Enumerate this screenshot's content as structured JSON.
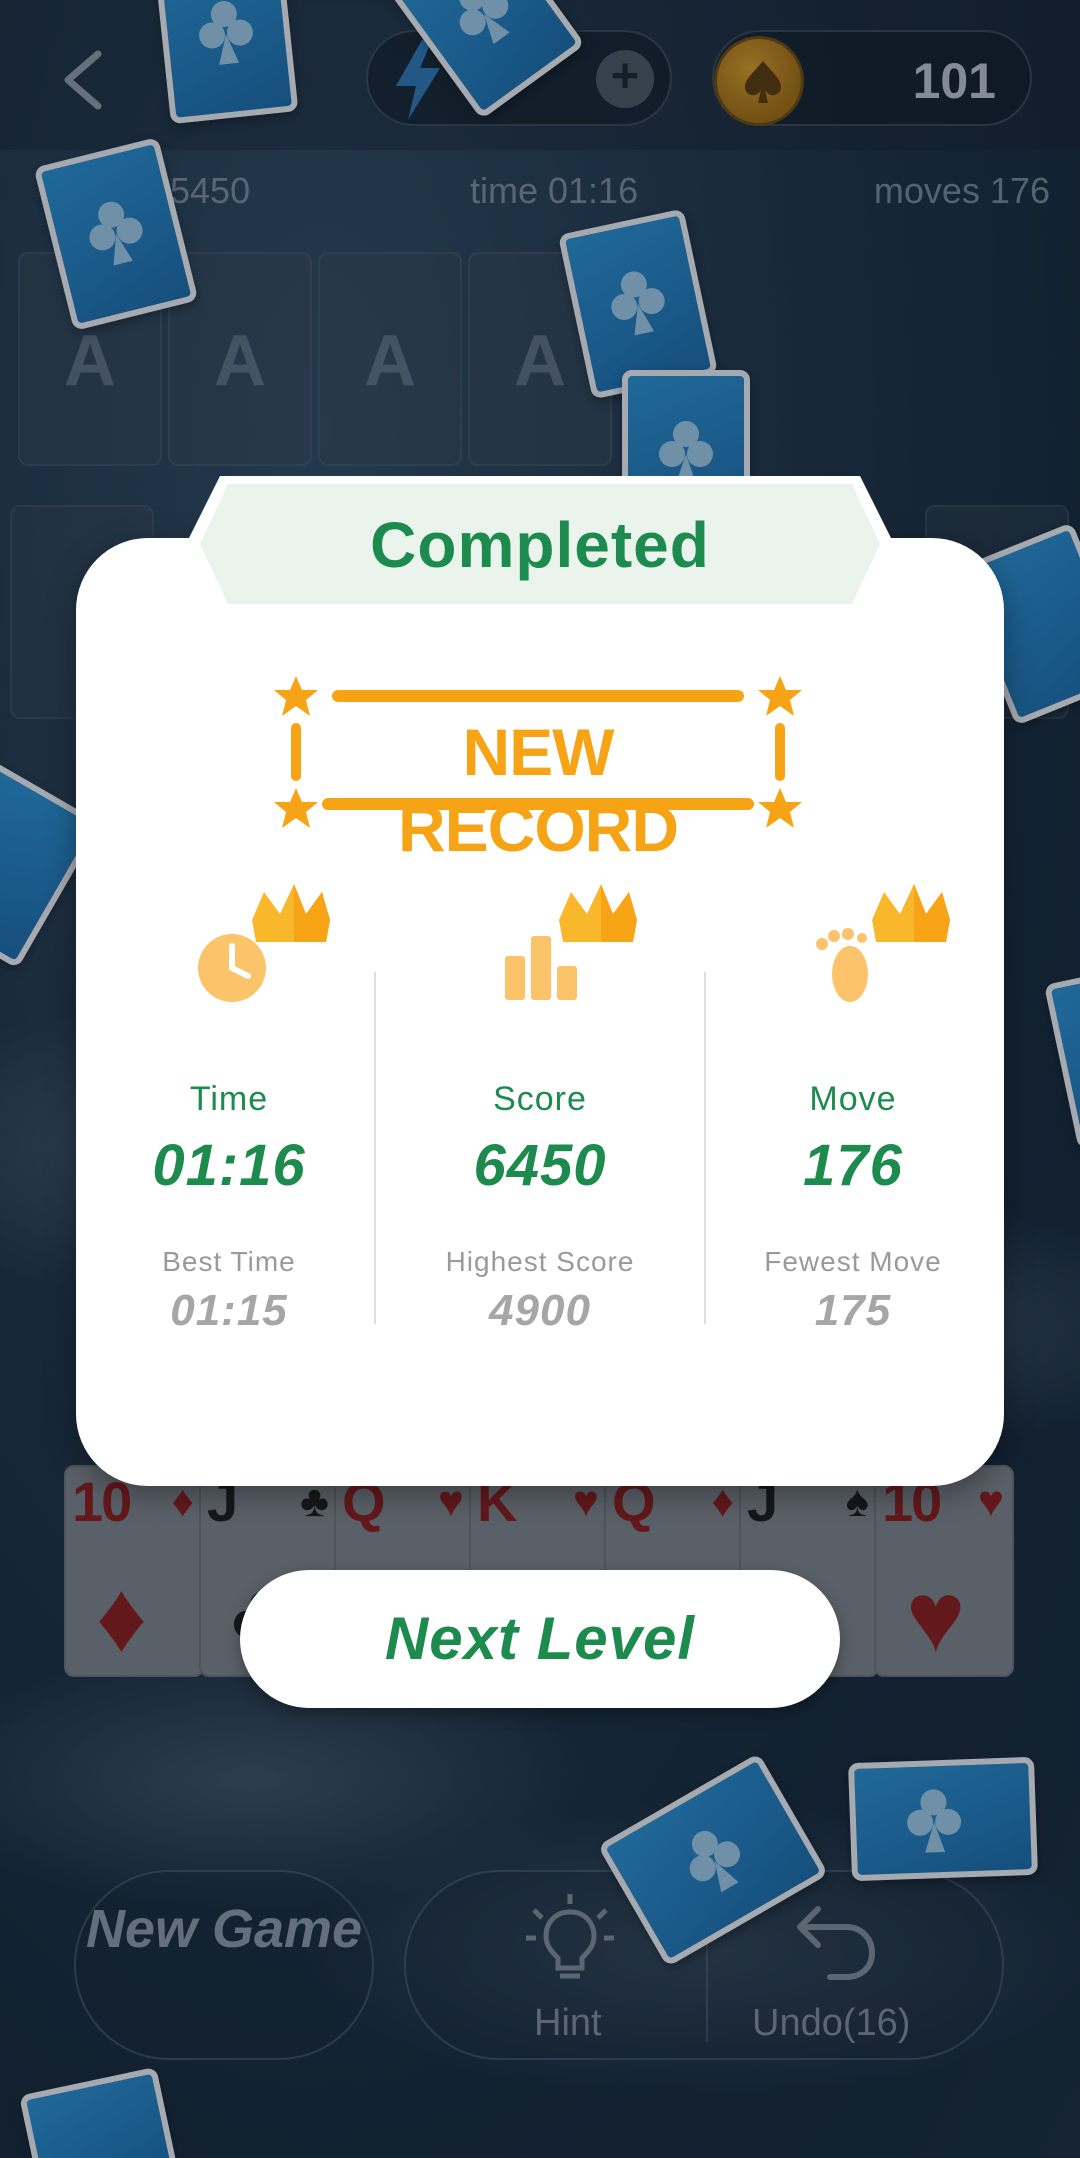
{
  "topbar": {
    "energy_plus": "+",
    "coins": "101"
  },
  "stats": {
    "score": "5450",
    "time": "time 01:16",
    "moves": "moves 176"
  },
  "foundations": [
    "A",
    "A",
    "A",
    "A"
  ],
  "tableau_cards": [
    {
      "rank": "10",
      "suit": "♦",
      "color": "red"
    },
    {
      "rank": "J",
      "suit": "♣",
      "color": "black"
    },
    {
      "rank": "Q",
      "suit": "♥",
      "color": "red"
    },
    {
      "rank": "K",
      "suit": "♥",
      "color": "red"
    },
    {
      "rank": "Q",
      "suit": "♦",
      "color": "red"
    },
    {
      "rank": "J",
      "suit": "♠",
      "color": "black"
    },
    {
      "rank": "10",
      "suit": "♥",
      "color": "red"
    }
  ],
  "modal": {
    "title": "Completed",
    "badge": "NEW RECORD",
    "columns": [
      {
        "label": "Time",
        "value": "01:16",
        "best_label": "Best Time",
        "best_value": "01:15",
        "icon": "clock-crown-icon"
      },
      {
        "label": "Score",
        "value": "6450",
        "best_label": "Highest Score",
        "best_value": "4900",
        "icon": "bar-chart-crown-icon"
      },
      {
        "label": "Move",
        "value": "176",
        "best_label": "Fewest Move",
        "best_value": "175",
        "icon": "footprint-crown-icon"
      }
    ],
    "next_button": "Next Level"
  },
  "bottom": {
    "new_game": "New Game",
    "hint": "Hint",
    "undo": "Undo(16)"
  },
  "colors": {
    "accent_green": "#1d8a4e",
    "record_orange": "#f6a316",
    "gold": "#f9b82b",
    "card_blue": "#2a8fd0"
  }
}
